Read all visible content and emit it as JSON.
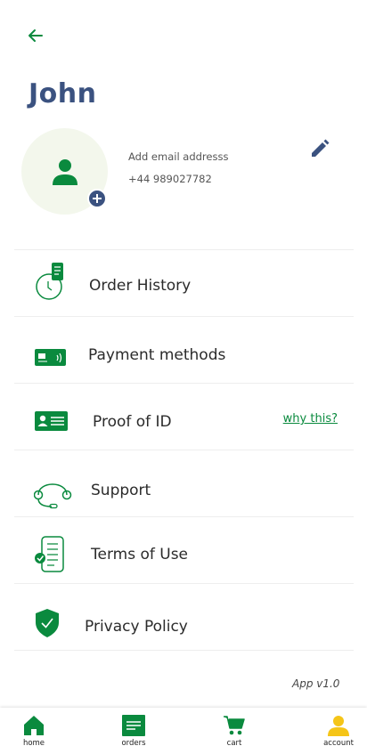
{
  "header": {
    "user_name": "John"
  },
  "profile": {
    "email_placeholder": "Add email addresss",
    "phone": "+44 989027782"
  },
  "menu": {
    "order_history": "Order History",
    "payment_methods": "Payment methods",
    "proof_of_id": "Proof of ID",
    "why_this": "why this?",
    "support": "Support",
    "terms": "Terms of Use",
    "privacy": "Privacy Policy"
  },
  "footer": {
    "app_version": "App v1.0"
  },
  "bottom_nav": {
    "home": "home",
    "orders": "orders",
    "cart": "cart",
    "account": "account"
  },
  "colors": {
    "brand_green": "#0a8a3e",
    "name_blue": "#3b5280",
    "account_yellow": "#f5c518",
    "avatar_bg": "#f3f7ec"
  },
  "icons": {
    "back": "arrow-left-icon",
    "edit": "pencil-icon",
    "order_history": "clock-receipt-icon",
    "payment": "payment-card-icon",
    "proof_id": "id-card-icon",
    "support": "headset-icon",
    "terms": "document-check-icon",
    "privacy": "shield-check-icon"
  }
}
